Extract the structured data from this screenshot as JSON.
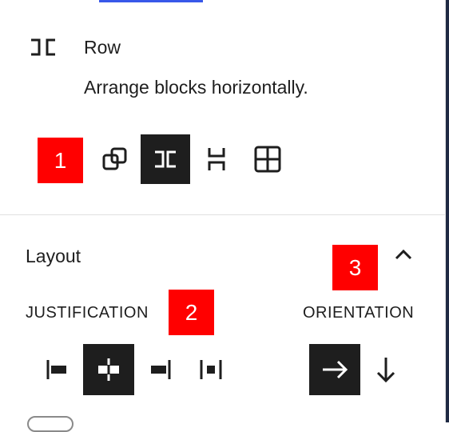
{
  "block_card": {
    "title": "Row",
    "description": "Arrange blocks horizontally.",
    "icon": "row-icon"
  },
  "variations": [
    {
      "name": "group",
      "icon": "group-icon",
      "active": false
    },
    {
      "name": "row",
      "icon": "row-icon",
      "active": true
    },
    {
      "name": "stack",
      "icon": "stack-icon",
      "active": false
    },
    {
      "name": "grid",
      "icon": "grid-icon",
      "active": false
    }
  ],
  "layout": {
    "title": "Layout",
    "collapse_icon": "chevron-up-icon",
    "justification_label": "JUSTIFICATION",
    "orientation_label": "ORIENTATION",
    "justification": [
      {
        "name": "justify-left",
        "icon": "justify-left-icon",
        "active": false
      },
      {
        "name": "justify-center",
        "icon": "justify-center-icon",
        "active": true
      },
      {
        "name": "justify-right",
        "icon": "justify-right-icon",
        "active": false
      },
      {
        "name": "justify-space-between",
        "icon": "justify-space-between-icon",
        "active": false
      }
    ],
    "orientation": [
      {
        "name": "horizontal",
        "icon": "arrow-right-icon",
        "active": true
      },
      {
        "name": "vertical",
        "icon": "arrow-down-icon",
        "active": false
      }
    ]
  },
  "annotations": [
    "1",
    "2",
    "3"
  ],
  "colors": {
    "accent": "#3858e9",
    "badge": "#ff0000",
    "active_bg": "#1e1e1e"
  }
}
